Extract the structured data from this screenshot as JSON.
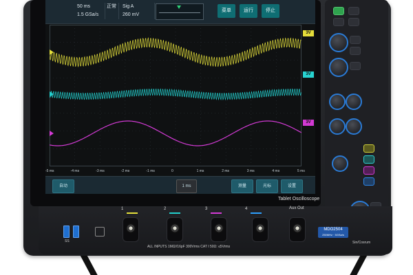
{
  "device": {
    "model_badge": "MDO2504",
    "model_badge_sub": "250MHz · 5GSa/s",
    "tablet_label": "Tablet Oscilloscope",
    "inputs_note": "ALL INPUTS 1MΩ//16pF 300Vrms CAT I   50Ω: ≤5Vrms",
    "aux_out_label": "Aux Out",
    "usb_label": "SS",
    "brand_bottom": "Sin/Cosrum"
  },
  "screen": {
    "topbar": {
      "timebase": "50 ms",
      "samplerate": "1.5 GSa/s",
      "mode": "正常",
      "acq": "Sig A",
      "trigger_level": "260 mV",
      "buttons": [
        "菜单",
        "运行",
        "停止"
      ]
    },
    "axis_ticks": [
      "-5 ms",
      "-4 ms",
      "-3 ms",
      "-2 ms",
      "-1 ms",
      "0",
      "1 ms",
      "2 ms",
      "3 ms",
      "4 ms",
      "5 ms"
    ],
    "bottom_buttons": [
      "自动",
      "1 ms",
      "测量",
      "光标",
      "设置"
    ],
    "channel_tags": [
      {
        "label": "3V",
        "color": "#e5dd3a"
      },
      {
        "label": "3V",
        "color": "#27d3d1"
      },
      {
        "label": "3V",
        "color": "#d23ad4"
      }
    ]
  },
  "traces": {
    "yellow": "#e6e13b",
    "cyan": "#23d1cf",
    "magenta": "#d63bd8"
  },
  "front_channels": [
    {
      "number": "1",
      "color": "#e6e13b"
    },
    {
      "number": "2",
      "color": "#23d1cf"
    },
    {
      "number": "3",
      "color": "#d63bd8"
    },
    {
      "number": "4",
      "color": "#2ea0ff"
    }
  ]
}
